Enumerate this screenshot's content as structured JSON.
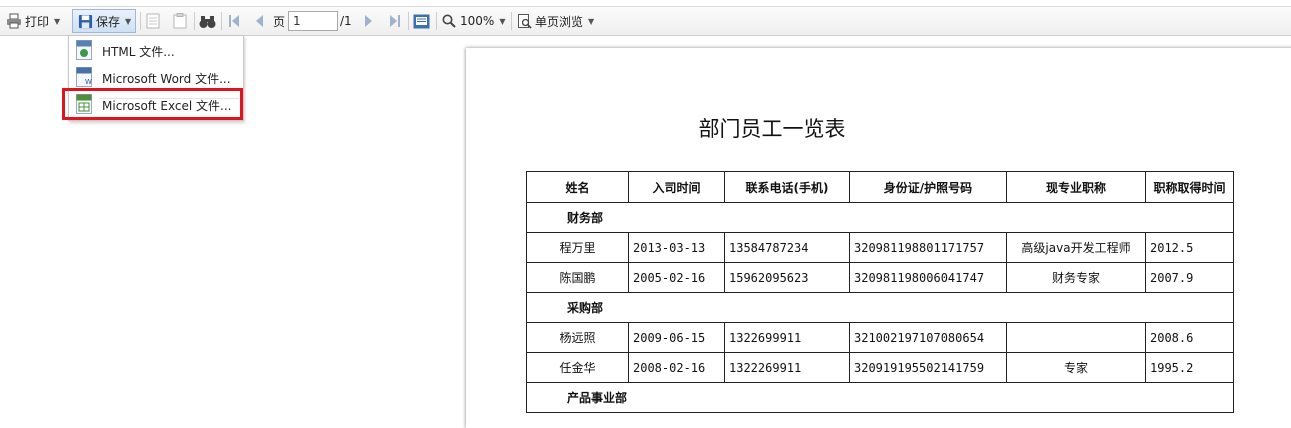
{
  "toolbar": {
    "print_label": "打印",
    "save_label": "保存",
    "page_label": "页",
    "page_value": "1",
    "page_total": "/1",
    "zoom_label": "100%",
    "view_label": "单页浏览"
  },
  "save_menu": {
    "items": [
      {
        "label": "HTML 文件...",
        "icon": "html-file-icon"
      },
      {
        "label": "Microsoft Word 文件...",
        "icon": "word-file-icon"
      },
      {
        "label": "Microsoft Excel 文件...",
        "icon": "excel-file-icon"
      }
    ],
    "highlight_color": "#e0141e"
  },
  "report": {
    "title": "部门员工一览表",
    "headers": [
      "姓名",
      "入司时间",
      "联系电话(手机)",
      "身份证/护照号码",
      "现专业职称",
      "职称取得时间"
    ],
    "departments": [
      {
        "name": "财务部",
        "rows": [
          [
            "程万里",
            "2013-03-13",
            "13584787234",
            "320981198801171757",
            "高级java开发工程师",
            "2012.5"
          ],
          [
            "陈国鹏",
            "2005-02-16",
            "15962095623",
            "320981198006041747",
            "财务专家",
            "2007.9"
          ]
        ]
      },
      {
        "name": "采购部",
        "rows": [
          [
            "杨远照",
            "2009-06-15",
            "1322699911",
            "321002197107080654",
            "",
            "2008.6"
          ],
          [
            "任金华",
            "2008-02-16",
            "1322269911",
            "320919195502141759",
            "专家",
            "1995.2"
          ]
        ]
      },
      {
        "name": "产品事业部",
        "rows": []
      }
    ]
  }
}
